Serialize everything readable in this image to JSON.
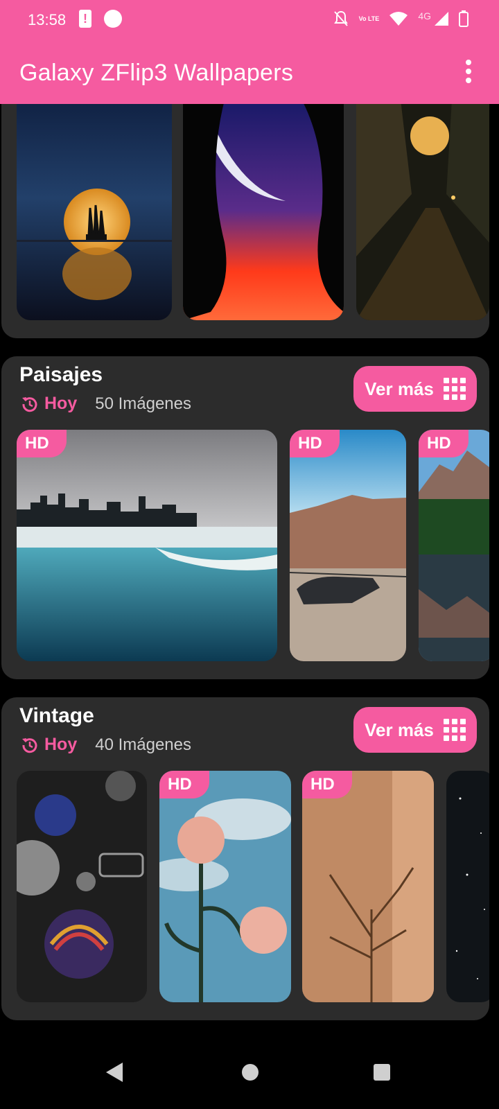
{
  "status_bar": {
    "time": "13:58",
    "network": "4G",
    "volte": "Vo LTE"
  },
  "app_bar": {
    "title": "Galaxy ZFlip3 Wallpapers"
  },
  "hd_badge": "HD",
  "sections": [
    {
      "title": "Paisajes",
      "when": "Hoy",
      "count_label": "50 Imágenes",
      "more_label": "Ver más"
    },
    {
      "title": "Vintage",
      "when": "Hoy",
      "count_label": "40 Imágenes",
      "more_label": "Ver más"
    }
  ],
  "colors": {
    "accent": "#F55BA0",
    "card": "#2c2c2c",
    "background": "#000000"
  }
}
